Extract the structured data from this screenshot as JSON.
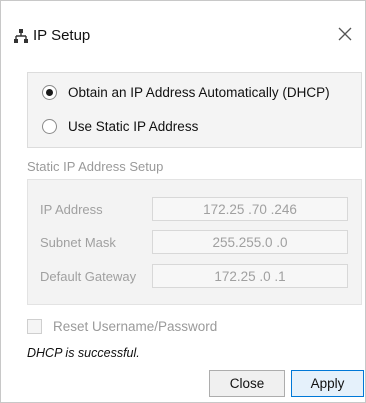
{
  "window": {
    "title": "IP Setup",
    "icon": "network-icon"
  },
  "mode": {
    "options": [
      {
        "label": "Obtain an IP Address Automatically (DHCP)",
        "selected": true
      },
      {
        "label": "Use Static IP Address",
        "selected": false
      }
    ]
  },
  "static_setup": {
    "title": "Static IP Address Setup",
    "fields": [
      {
        "label": "IP Address",
        "value": "172.25 .70 .246"
      },
      {
        "label": "Subnet Mask",
        "value": "255.255.0  .0"
      },
      {
        "label": "Default Gateway",
        "value": "172.25 .0  .1"
      }
    ]
  },
  "reset": {
    "label": "Reset Username/Password",
    "checked": false
  },
  "status": {
    "text": "DHCP is successful."
  },
  "buttons": {
    "close_label": "Close",
    "apply_label": "Apply"
  }
}
